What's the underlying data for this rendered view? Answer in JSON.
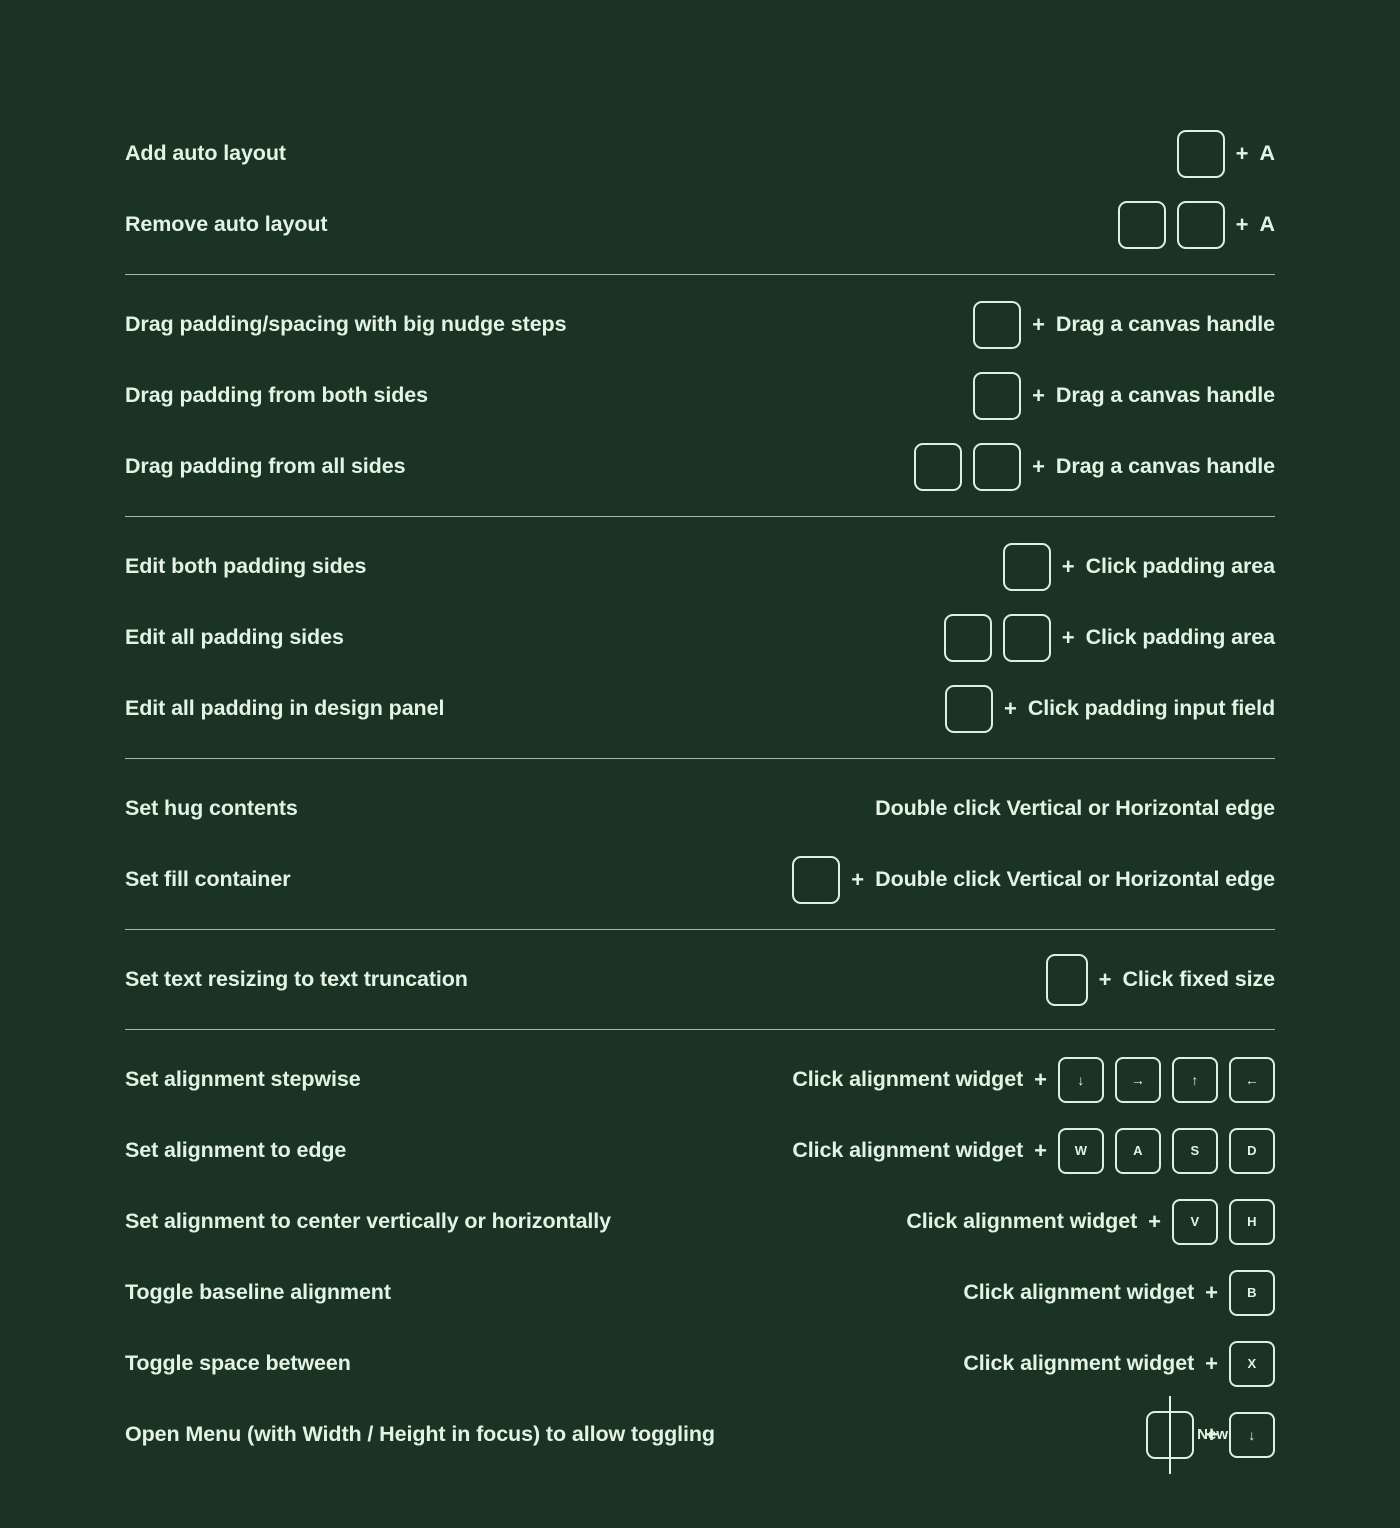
{
  "theme": {
    "background": "#1b3322",
    "foreground": "#e3f3e4",
    "key_border": "#dff0e2",
    "divider": "#cfe8d4"
  },
  "badge": {
    "new_label": "New"
  },
  "symbols": {
    "plus": "+",
    "arrow_down": "↓",
    "arrow_right": "→",
    "arrow_up": "↑",
    "arrow_left": "←"
  },
  "groups": [
    {
      "id": "auto-layout",
      "rows": [
        {
          "label": "Add auto layout",
          "keys": [
            ""
          ],
          "plus": "+",
          "action": "A",
          "action_style": "letter"
        },
        {
          "label": "Remove auto layout",
          "keys": [
            "",
            ""
          ],
          "plus": "+",
          "action": "A",
          "action_style": "letter"
        }
      ]
    },
    {
      "id": "drag-padding",
      "rows": [
        {
          "label": "Drag padding/spacing with big nudge steps",
          "keys": [
            ""
          ],
          "plus": "+",
          "action": "Drag a canvas handle",
          "action_style": "text"
        },
        {
          "label": "Drag padding from both sides",
          "keys": [
            ""
          ],
          "plus": "+",
          "action": "Drag a canvas handle",
          "action_style": "text"
        },
        {
          "label": "Drag padding from all sides",
          "keys": [
            "",
            ""
          ],
          "plus": "+",
          "action": "Drag a canvas handle",
          "action_style": "text"
        }
      ]
    },
    {
      "id": "edit-padding",
      "rows": [
        {
          "label": "Edit both padding sides",
          "keys": [
            ""
          ],
          "plus": "+",
          "action": "Click padding area",
          "action_style": "text"
        },
        {
          "label": "Edit all padding sides",
          "keys": [
            "",
            ""
          ],
          "plus": "+",
          "action": "Click padding area",
          "action_style": "text"
        },
        {
          "label": "Edit all padding in design panel",
          "keys": [
            ""
          ],
          "plus": "+",
          "action": "Click padding input field",
          "action_style": "text"
        }
      ]
    },
    {
      "id": "resizing",
      "rows": [
        {
          "label": "Set hug contents",
          "keys": [],
          "plus": "",
          "action": "Double click Vertical or Horizontal edge",
          "action_style": "text"
        },
        {
          "label": "Set fill container",
          "keys": [
            ""
          ],
          "plus": "+",
          "action": "Double click Vertical or Horizontal edge",
          "action_style": "text"
        }
      ]
    },
    {
      "id": "text-resizing",
      "rows": [
        {
          "label": "Set text resizing to text truncation",
          "keys": [
            ""
          ],
          "key_shape": "tall",
          "plus": "+",
          "action": "Click fixed size",
          "action_style": "text"
        }
      ]
    },
    {
      "id": "alignment",
      "rows": [
        {
          "label": "Set alignment stepwise",
          "pre_action": "Click alignment widget",
          "plus": "+",
          "letter_keys": [
            "↓",
            "→",
            "↑",
            "←"
          ]
        },
        {
          "label": "Set alignment to edge",
          "pre_action": "Click alignment widget",
          "plus": "+",
          "letter_keys": [
            "W",
            "A",
            "S",
            "D"
          ]
        },
        {
          "label": "Set alignment to center vertically or horizontally",
          "pre_action": "Click alignment widget",
          "plus": "+",
          "letter_keys": [
            "V",
            "H"
          ]
        },
        {
          "label": "Toggle baseline alignment",
          "pre_action": "Click alignment widget",
          "plus": "+",
          "letter_keys": [
            "B"
          ]
        },
        {
          "label": "Toggle space between",
          "pre_action": "Click alignment widget",
          "plus": "+",
          "letter_keys": [
            "X"
          ]
        },
        {
          "label": "Open Menu (with Width / Height in focus) to allow toggling",
          "keys": [
            ""
          ],
          "plus": "+",
          "letter_keys": [
            "↓"
          ],
          "badge": "New"
        }
      ]
    }
  ]
}
